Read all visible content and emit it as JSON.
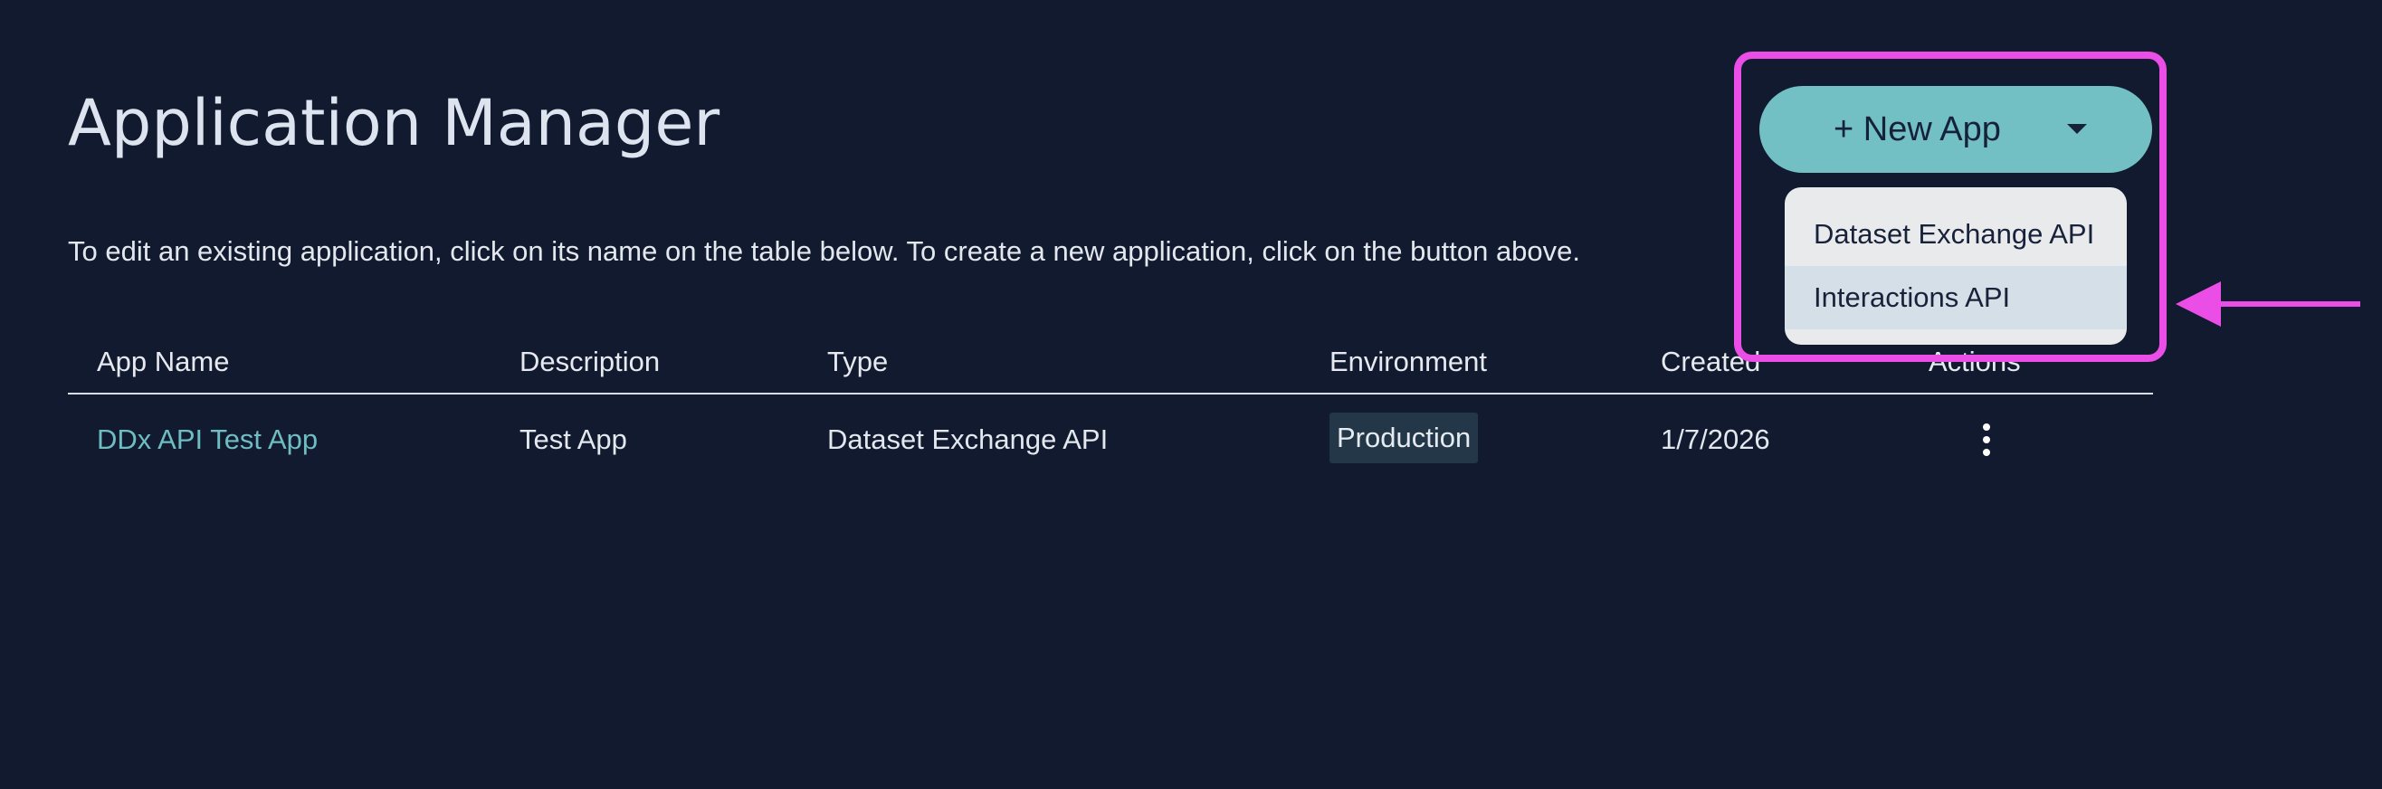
{
  "header": {
    "title": "Application Manager",
    "intro": "To edit an existing application, click on its name on the table below. To create a new application, click on the button above."
  },
  "new_app": {
    "label": "+ New App",
    "caret_icon": "caret-down-icon",
    "menu": [
      {
        "label": "Dataset Exchange API"
      },
      {
        "label": "Interactions API"
      }
    ]
  },
  "table": {
    "columns": [
      "App Name",
      "Description",
      "Type",
      "Environment",
      "Created",
      "Actions"
    ],
    "rows": [
      {
        "app_name": "DDx API Test App",
        "description": "Test App",
        "type": "Dataset Exchange API",
        "environment": "Production",
        "created": "1/7/2026",
        "actions_icon": "kebab-menu-icon"
      }
    ]
  },
  "colors": {
    "background": "#111a2e",
    "accent": "#73c0c4",
    "link": "#6fbcc2",
    "annotation": "#ea4ee6"
  }
}
